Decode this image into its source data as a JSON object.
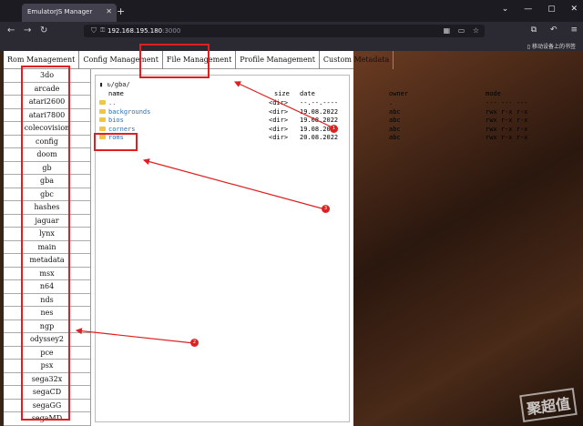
{
  "browser": {
    "tab_title": "EmulatorJS Manager",
    "url_host": "192.168.195.180",
    "url_port": ":3000",
    "mobile_bookmarks": "移动设备上的书签"
  },
  "topnav": [
    "Rom Management",
    "Config Management",
    "File Management",
    "Profile Management",
    "Custom Metadata"
  ],
  "sidebar": [
    "3do",
    "arcade",
    "atari2600",
    "atari7800",
    "colecovision",
    "config",
    "doom",
    "gb",
    "gba",
    "gbc",
    "hashes",
    "jaguar",
    "lynx",
    "main",
    "metadata",
    "msx",
    "n64",
    "nds",
    "nes",
    "ngp",
    "odyssey2",
    "pce",
    "psx",
    "sega32x",
    "segaCD",
    "segaGG",
    "segaMD"
  ],
  "file_panel": {
    "path": "/gba/",
    "columns": {
      "name": "name",
      "size": "size",
      "date": "date",
      "owner": "owner",
      "mode": "mode"
    },
    "rows": [
      {
        "name": "..",
        "size": "<dir>",
        "date": "--.--.----",
        "owner": ".",
        "mode": "--- --- ---"
      },
      {
        "name": "backgrounds",
        "size": "<dir>",
        "date": "19.08.2022",
        "owner": "abc",
        "mode": "rwx r-x r-x"
      },
      {
        "name": "bios",
        "size": "<dir>",
        "date": "19.08.2022",
        "owner": "abc",
        "mode": "rwx r-x r-x"
      },
      {
        "name": "corners",
        "size": "<dir>",
        "date": "19.08.2022",
        "owner": "abc",
        "mode": "rwx r-x r-x"
      },
      {
        "name": "roms",
        "size": "<dir>",
        "date": "20.08.2022",
        "owner": "abc",
        "mode": "rwx r-x r-x"
      }
    ]
  },
  "annotations": {
    "m1": "1",
    "m2": "2",
    "m3": "3"
  },
  "watermark": "聚超值",
  "colors": {
    "annotation": "#e02020",
    "folder": "#f4c542",
    "link": "#2a6fb5"
  }
}
